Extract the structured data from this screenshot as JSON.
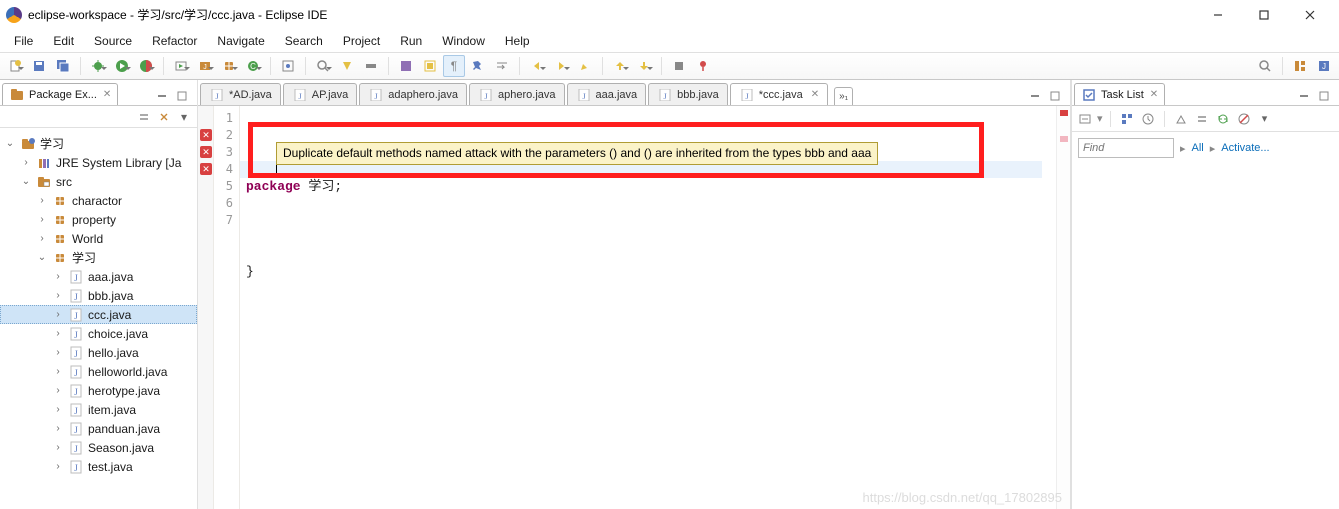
{
  "window": {
    "title": "eclipse-workspace - 学习/src/学习/ccc.java - Eclipse IDE"
  },
  "menu": [
    "File",
    "Edit",
    "Source",
    "Refactor",
    "Navigate",
    "Search",
    "Project",
    "Run",
    "Window",
    "Help"
  ],
  "package_explorer": {
    "title": "Package Ex...",
    "project_label": "学习",
    "jre_label": "JRE System Library [Ja",
    "src_label": "src",
    "packages": [
      "charactor",
      "property",
      "World",
      "学习"
    ],
    "study_files": [
      "aaa.java",
      "bbb.java",
      "ccc.java",
      "choice.java",
      "hello.java",
      "helloworld.java",
      "herotype.java",
      "item.java",
      "panduan.java",
      "Season.java",
      "test.java"
    ],
    "selected_file": "ccc.java"
  },
  "editor_tabs": [
    {
      "label": "*AD.java",
      "dirty": true,
      "active": false
    },
    {
      "label": "AP.java",
      "dirty": false,
      "active": false
    },
    {
      "label": "adaphero.java",
      "dirty": false,
      "active": false
    },
    {
      "label": "aphero.java",
      "dirty": false,
      "active": false
    },
    {
      "label": "aaa.java",
      "dirty": false,
      "active": false
    },
    {
      "label": "bbb.java",
      "dirty": false,
      "active": false
    },
    {
      "label": "*ccc.java",
      "dirty": true,
      "active": true
    }
  ],
  "editor_tabs_more": "»₁",
  "editor": {
    "line_numbers": [
      "1",
      "2",
      "3",
      "4",
      "5",
      "6",
      "7"
    ],
    "code_lines": [
      {
        "segments": [
          {
            "t": "package ",
            "cls": "kw"
          },
          {
            "t": "学习;",
            "cls": ""
          }
        ]
      },
      {
        "segments": []
      },
      {
        "segments": []
      },
      {
        "segments": []
      },
      {
        "segments": []
      },
      {
        "segments": [
          {
            "t": "}",
            "cls": ""
          }
        ]
      },
      {
        "segments": []
      }
    ],
    "current_line_index": 3,
    "tooltip": "Duplicate default methods named attack with the parameters () and () are inherited from the types bbb and aaa"
  },
  "task_list": {
    "title": "Task List",
    "find_placeholder": "Find",
    "all_label": "All",
    "activate_label": "Activate..."
  },
  "watermark": "https://blog.csdn.net/qq_17802895"
}
